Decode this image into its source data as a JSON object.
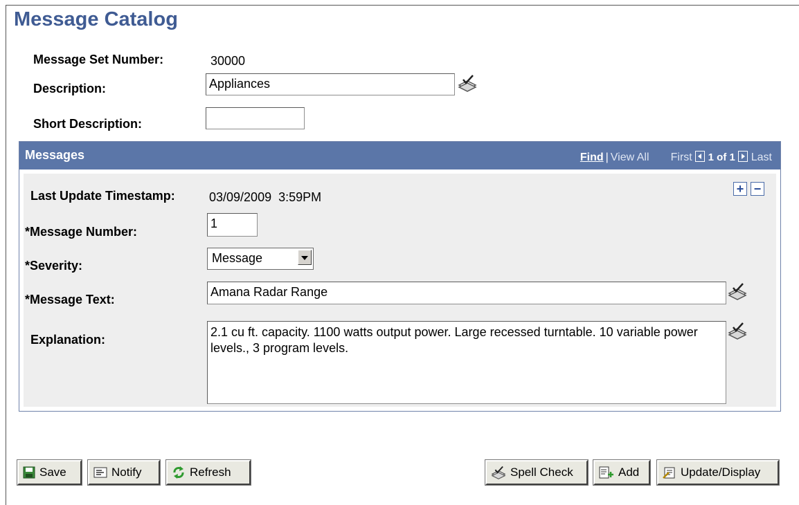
{
  "page": {
    "title": "Message Catalog"
  },
  "header_fields": {
    "message_set_number_label": "Message Set Number:",
    "message_set_number_value": "30000",
    "description_label": "Description:",
    "description_value": "Appliances",
    "short_description_label": "Short Description:",
    "short_description_value": ""
  },
  "messages": {
    "title": "Messages",
    "nav": {
      "find": "Find",
      "separator": "|",
      "view_all": "View All",
      "first": "First",
      "count": "1 of 1",
      "last": "Last"
    },
    "add_row_label": "+",
    "delete_row_label": "−",
    "last_update_label": "Last Update Timestamp:",
    "last_update_value": "03/09/2009  3:59PM",
    "message_number_label": "*Message Number:",
    "message_number_value": "1",
    "severity_label": "*Severity:",
    "severity_value": "Message",
    "message_text_label": "*Message Text:",
    "message_text_value": "Amana Radar Range",
    "explanation_label": "Explanation:",
    "explanation_value": "2.1 cu ft. capacity. 1100 watts output power. Large recessed turntable. 10 variable power levels., 3 program levels."
  },
  "toolbar": {
    "save_label": "Save",
    "notify_label": "Notify",
    "refresh_label": "Refresh",
    "spell_check_label": "Spell Check",
    "add_label": "Add",
    "update_display_label": "Update/Display"
  },
  "colors": {
    "title": "#3f5b93",
    "grid_header": "#5b76a8",
    "grid_body": "#eeeeee",
    "button_face": "#e9e9e1"
  },
  "icons": [
    "spell-check-icon",
    "save-icon",
    "notify-icon",
    "refresh-icon",
    "add-icon",
    "update-display-icon",
    "previous-arrow-icon",
    "next-arrow-icon"
  ]
}
